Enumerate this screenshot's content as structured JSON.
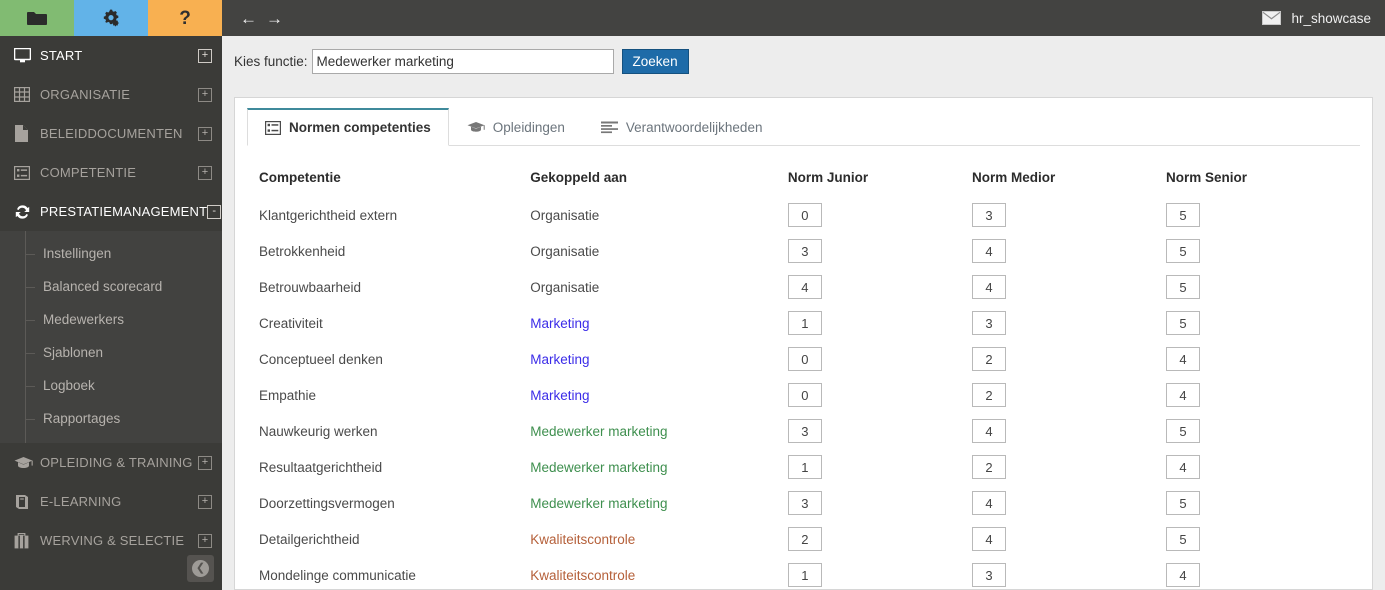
{
  "sidebar": {
    "quick_buttons": [
      {
        "name": "folder",
        "icon": "folder-icon",
        "color": "#81bb72"
      },
      {
        "name": "settings",
        "icon": "gears-icon",
        "color": "#62b3e8"
      },
      {
        "name": "help",
        "icon": "question-mark-icon",
        "label": "?",
        "color": "#f8b051"
      }
    ],
    "items": [
      {
        "label": "START",
        "icon": "monitor-icon",
        "toggle": "+",
        "active": true
      },
      {
        "label": "ORGANISATIE",
        "icon": "grid-icon",
        "toggle": "+",
        "active": false
      },
      {
        "label": "BELEIDDOCUMENTEN",
        "icon": "document-icon",
        "toggle": "+",
        "active": false
      },
      {
        "label": "COMPETENTIE",
        "icon": "list-icon",
        "toggle": "+",
        "active": false
      },
      {
        "label": "PRESTATIEMANAGEMENT",
        "icon": "refresh-icon",
        "toggle": "-",
        "active": true
      }
    ],
    "submenu": [
      {
        "label": "Instellingen"
      },
      {
        "label": "Balanced scorecard"
      },
      {
        "label": "Medewerkers"
      },
      {
        "label": "Sjablonen"
      },
      {
        "label": "Logboek"
      },
      {
        "label": "Rapportages"
      }
    ],
    "items_after": [
      {
        "label": "OPLEIDING & TRAINING",
        "icon": "graduation-cap-icon",
        "toggle": "+",
        "active": false
      },
      {
        "label": "E-LEARNING",
        "icon": "book-icon",
        "toggle": "+",
        "active": false
      },
      {
        "label": "WERVING & SELECTIE",
        "icon": "briefcase-icon",
        "toggle": "+",
        "active": false
      }
    ],
    "collapse_icon": "arrow-left-circle-icon"
  },
  "topbar": {
    "back_arrow": "←",
    "forward_arrow": "→",
    "mail_icon": "envelope-icon",
    "user": "hr_showcase"
  },
  "search": {
    "label": "Kies functie:",
    "value": "Medewerker marketing",
    "placeholder": "",
    "button": "Zoeken"
  },
  "tabs": [
    {
      "label": "Normen competenties",
      "icon": "list-panel-icon",
      "active": true
    },
    {
      "label": "Opleidingen",
      "icon": "graduation-cap-icon",
      "active": false
    },
    {
      "label": "Verantwoordelijkheden",
      "icon": "lines-icon",
      "active": false
    }
  ],
  "table": {
    "headers": [
      "Competentie",
      "Gekoppeld aan",
      "Norm Junior",
      "Norm Medior",
      "Norm Senior"
    ],
    "rows": [
      {
        "competentie": "Klantgerichtheid extern",
        "gekoppeld": "Organisatie",
        "link_type": "plain",
        "junior": "0",
        "medior": "3",
        "senior": "5"
      },
      {
        "competentie": "Betrokkenheid",
        "gekoppeld": "Organisatie",
        "link_type": "plain",
        "junior": "3",
        "medior": "4",
        "senior": "5"
      },
      {
        "competentie": "Betrouwbaarheid",
        "gekoppeld": "Organisatie",
        "link_type": "plain",
        "junior": "4",
        "medior": "4",
        "senior": "5"
      },
      {
        "competentie": "Creativiteit",
        "gekoppeld": "Marketing",
        "link_type": "blue",
        "junior": "1",
        "medior": "3",
        "senior": "5"
      },
      {
        "competentie": "Conceptueel denken",
        "gekoppeld": "Marketing",
        "link_type": "blue",
        "junior": "0",
        "medior": "2",
        "senior": "4"
      },
      {
        "competentie": "Empathie",
        "gekoppeld": "Marketing",
        "link_type": "blue",
        "junior": "0",
        "medior": "2",
        "senior": "4"
      },
      {
        "competentie": "Nauwkeurig werken",
        "gekoppeld": "Medewerker marketing",
        "link_type": "green",
        "junior": "3",
        "medior": "4",
        "senior": "5"
      },
      {
        "competentie": "Resultaatgerichtheid",
        "gekoppeld": "Medewerker marketing",
        "link_type": "green",
        "junior": "1",
        "medior": "2",
        "senior": "4"
      },
      {
        "competentie": "Doorzettingsvermogen",
        "gekoppeld": "Medewerker marketing",
        "link_type": "green",
        "junior": "3",
        "medior": "4",
        "senior": "5"
      },
      {
        "competentie": "Detailgerichtheid",
        "gekoppeld": "Kwaliteitscontrole",
        "link_type": "brown",
        "junior": "2",
        "medior": "4",
        "senior": "5"
      },
      {
        "competentie": "Mondelinge communicatie",
        "gekoppeld": "Kwaliteitscontrole",
        "link_type": "brown",
        "junior": "1",
        "medior": "3",
        "senior": "4"
      }
    ]
  },
  "colors": {
    "sidebar_bg": "#3b3b38",
    "submenu_bg": "#424240",
    "topbar_bg": "#434341",
    "accent_tab": "#3f8a9b",
    "search_button": "#1e6ba8",
    "link_blue": "#3b2ce8",
    "link_green": "#3e8f4e",
    "link_brown": "#b5603a"
  }
}
